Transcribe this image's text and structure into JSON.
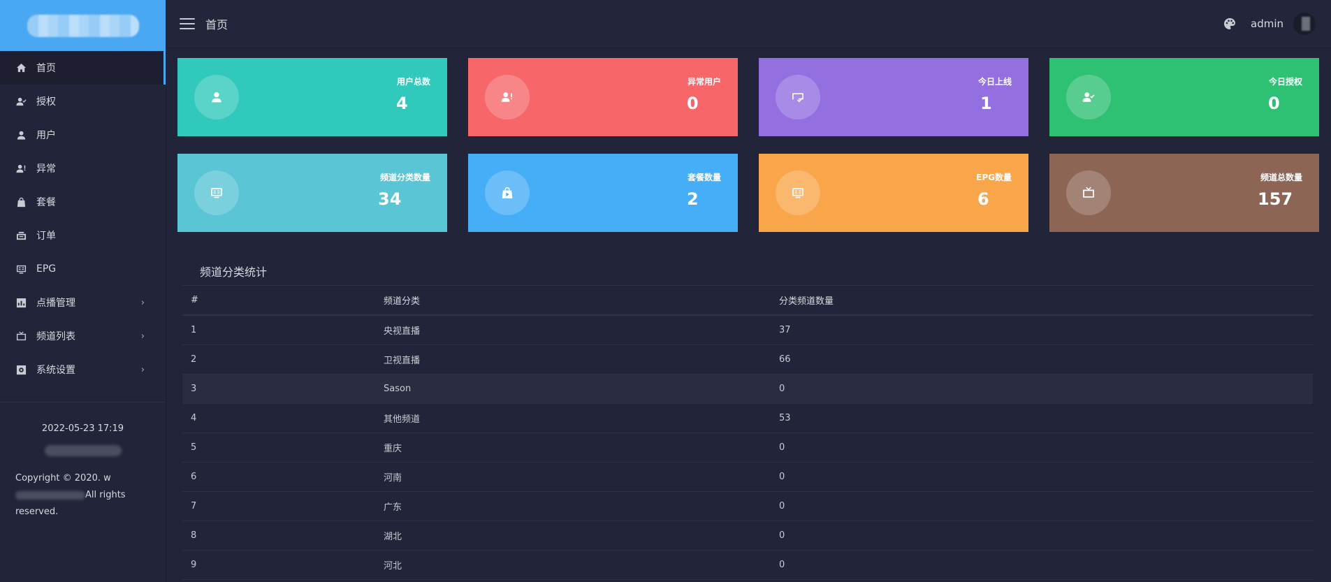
{
  "header": {
    "title": "首页",
    "username": "admin"
  },
  "sidebar": {
    "items": [
      {
        "label": "首页",
        "icon": "home-icon"
      },
      {
        "label": "授权",
        "icon": "user-check-icon"
      },
      {
        "label": "用户",
        "icon": "user-icon"
      },
      {
        "label": "异常",
        "icon": "user-alert-icon"
      },
      {
        "label": "套餐",
        "icon": "bag-icon"
      },
      {
        "label": "订单",
        "icon": "order-icon"
      },
      {
        "label": "EPG",
        "icon": "epg-icon"
      },
      {
        "label": "点播管理",
        "icon": "chart-icon"
      },
      {
        "label": "频道列表",
        "icon": "tv-icon"
      },
      {
        "label": "系统设置",
        "icon": "settings-icon"
      }
    ],
    "datetime": "2022-05-23 17:19",
    "copyright_1": "Copyright © 2020. w",
    "copyright_2": "All rights",
    "copyright_3": "reserved."
  },
  "cards": [
    {
      "label": "用户总数",
      "value": "4",
      "color": "#31c9bb"
    },
    {
      "label": "异常用户",
      "value": "0",
      "color": "#f7676a"
    },
    {
      "label": "今日上线",
      "value": "1",
      "color": "#936fe0"
    },
    {
      "label": "今日授权",
      "value": "0",
      "color": "#2fc173"
    },
    {
      "label": "频道分类数量",
      "value": "34",
      "color": "#59c5d5"
    },
    {
      "label": "套餐数量",
      "value": "2",
      "color": "#46aef7"
    },
    {
      "label": "EPG数量",
      "value": "6",
      "color": "#f9a54a"
    },
    {
      "label": "频道总数量",
      "value": "157",
      "color": "#8c6554"
    }
  ],
  "stats": {
    "title": "频道分类统计",
    "columns": [
      "#",
      "频道分类",
      "分类频道数量"
    ],
    "rows": [
      [
        "1",
        "央视直播",
        "37"
      ],
      [
        "2",
        "卫视直播",
        "66"
      ],
      [
        "3",
        "Sason",
        "0"
      ],
      [
        "4",
        "其他频道",
        "53"
      ],
      [
        "5",
        "重庆",
        "0"
      ],
      [
        "6",
        "河南",
        "0"
      ],
      [
        "7",
        "广东",
        "0"
      ],
      [
        "8",
        "湖北",
        "0"
      ],
      [
        "9",
        "河北",
        "0"
      ]
    ]
  }
}
